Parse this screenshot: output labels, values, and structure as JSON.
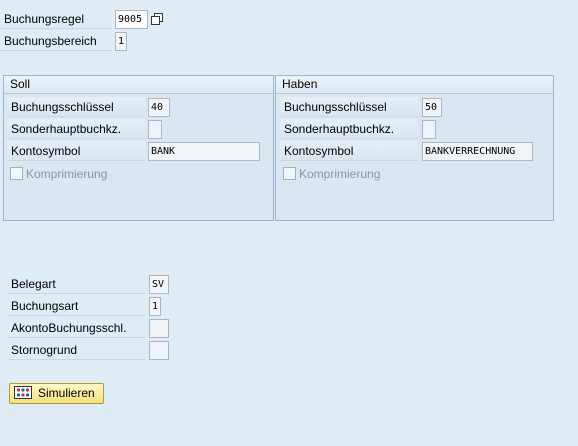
{
  "header": {
    "rule_label": "Buchungsregel",
    "rule_value": "9005",
    "area_label": "Buchungsbereich",
    "area_value": "1"
  },
  "soll": {
    "title": "Soll",
    "key_label": "Buchungsschlüssel",
    "key_value": "40",
    "special_label": "Sonderhauptbuchkz.",
    "special_value": "",
    "account_label": "Kontosymbol",
    "account_value": "BANK",
    "compress_label": "Komprimierung"
  },
  "haben": {
    "title": "Haben",
    "key_label": "Buchungsschlüssel",
    "key_value": "50",
    "special_label": "Sonderhauptbuchkz.",
    "special_value": "",
    "account_label": "Kontosymbol",
    "account_value": "BANKVERRECHNUNG",
    "compress_label": "Komprimierung"
  },
  "bottom": {
    "doctype_label": "Belegart",
    "doctype_value": "SV",
    "posttype_label": "Buchungsart",
    "posttype_value": "1",
    "akonto_label": "AkontoBuchungsschl.",
    "akonto_value": "",
    "storno_label": "Stornogrund",
    "storno_value": ""
  },
  "actions": {
    "simulate_label": "Simulieren",
    "simulate_icon": "simulate-icon"
  }
}
